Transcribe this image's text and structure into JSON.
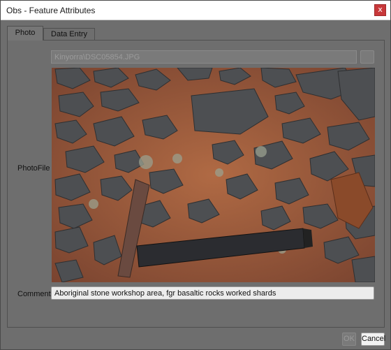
{
  "window": {
    "title": "Obs - Feature Attributes",
    "close_label": "x"
  },
  "tabs": [
    {
      "label": "Photo",
      "active": true
    },
    {
      "label": "Data Entry",
      "active": false
    }
  ],
  "form": {
    "photofile_label": "PhotoFile",
    "photofile_value": "Kinyorra\\DSC05854.JPG",
    "comments_label": "Comments",
    "comments_value": "Aboriginal stone workshop area, fgr basaltic rocks worked shards"
  },
  "buttons": {
    "ok_label": "OK",
    "cancel_label": "Cancel"
  },
  "colors": {
    "background": "#6e6e6e",
    "close_button": "#c8383a",
    "soil": "#9a5a3a",
    "rock": "#4d4f52"
  }
}
